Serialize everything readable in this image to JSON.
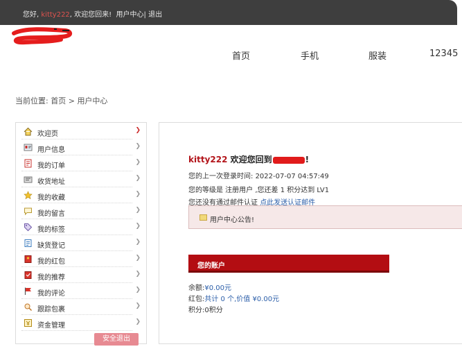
{
  "topbar": {
    "greeting": "您好,",
    "username": "kitty222",
    "welcome": ", 欢迎您回来!",
    "user_center": "用户中心",
    "separator": "|",
    "logout": "退出"
  },
  "nav": {
    "items": [
      "首页",
      "手机",
      "服装",
      "12345"
    ]
  },
  "breadcrumb": {
    "prefix": "当前位置:",
    "home": "首页",
    "separator": ">",
    "current": "用户中心"
  },
  "sidebar": {
    "items": [
      {
        "label": "欢迎页",
        "icon": "home-icon",
        "active": true
      },
      {
        "label": "用户信息",
        "icon": "id-card-icon"
      },
      {
        "label": "我的订单",
        "icon": "order-icon"
      },
      {
        "label": "收货地址",
        "icon": "address-icon"
      },
      {
        "label": "我的收藏",
        "icon": "star-icon"
      },
      {
        "label": "我的留言",
        "icon": "message-icon"
      },
      {
        "label": "我的标签",
        "icon": "tag-icon"
      },
      {
        "label": "缺货登记",
        "icon": "register-icon"
      },
      {
        "label": "我的红包",
        "icon": "red-packet-icon"
      },
      {
        "label": "我的推荐",
        "icon": "recommend-icon"
      },
      {
        "label": "我的评论",
        "icon": "flag-icon"
      },
      {
        "label": "跟踪包裹",
        "icon": "track-icon"
      },
      {
        "label": "资金管理",
        "icon": "funds-icon"
      }
    ],
    "logout_label": "安全退出"
  },
  "main": {
    "welcome_user": "kitty222",
    "welcome_text": "欢迎您回到",
    "welcome_end": "!",
    "last_login_label": "您的上一次登录时间:",
    "last_login": "2022-07-07 04:57:49",
    "level_text": "您的等级是 注册用户 ,您还差 1 积分达到 LV1",
    "email_text": "您还没有通过邮件认证",
    "email_link": "点此发送认证邮件",
    "notice": "用户中心公告!",
    "account_title": "您的账户",
    "balance_label": "余额:",
    "balance_value": "¥0.00元",
    "redpacket_label": "红包:",
    "redpacket_value": "共计 0 个,价值 ¥0.00元",
    "points_text": "积分:0积分"
  },
  "colors": {
    "topbar": "#3e3e3e",
    "accent_red": "#b30d12",
    "link_blue": "#2a5da8",
    "logout_pink": "#e78a92",
    "notice_bg": "#f6e8e8"
  }
}
